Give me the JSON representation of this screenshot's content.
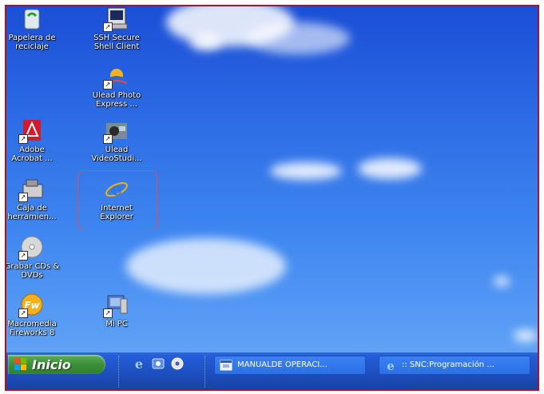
{
  "desktop": {
    "icons": [
      {
        "label": "Papelera de\nreciclaje",
        "icon": "recycle-bin-icon"
      },
      {
        "label": "SSH Secure\nShell Client",
        "icon": "ssh-client-icon"
      },
      {
        "label": "Ulead Photo\nExpress ...",
        "icon": "ulead-photo-express-icon"
      },
      {
        "label": "Adobe\nAcrobat ...",
        "icon": "adobe-acrobat-icon"
      },
      {
        "label": "Ulead\nVideoStudi...",
        "icon": "ulead-videostudio-icon"
      },
      {
        "label": "Caja de\nherramien...",
        "icon": "toolbox-icon"
      },
      {
        "label": "Internet\nExplorer",
        "icon": "internet-explorer-icon"
      },
      {
        "label": "Grabar CDs &\nDVDs",
        "icon": "cd-burner-icon"
      },
      {
        "label": "Macromedia\nFireworks 8",
        "icon": "fireworks-icon"
      },
      {
        "label": "Mi PC",
        "icon": "my-computer-icon"
      }
    ]
  },
  "taskbar": {
    "start_label": "Inicio",
    "quick_launch": [
      "internet-explorer-icon",
      "outlook-icon",
      "media-player-icon"
    ],
    "tasks": [
      {
        "label": "MANUALDE OPERACI...",
        "icon": "document-window-icon"
      },
      {
        "label": ":: SNC:Programación ...",
        "icon": "internet-explorer-icon"
      }
    ]
  },
  "colors": {
    "highlight_border": "#e05050",
    "frame_border": "#b0121b"
  }
}
